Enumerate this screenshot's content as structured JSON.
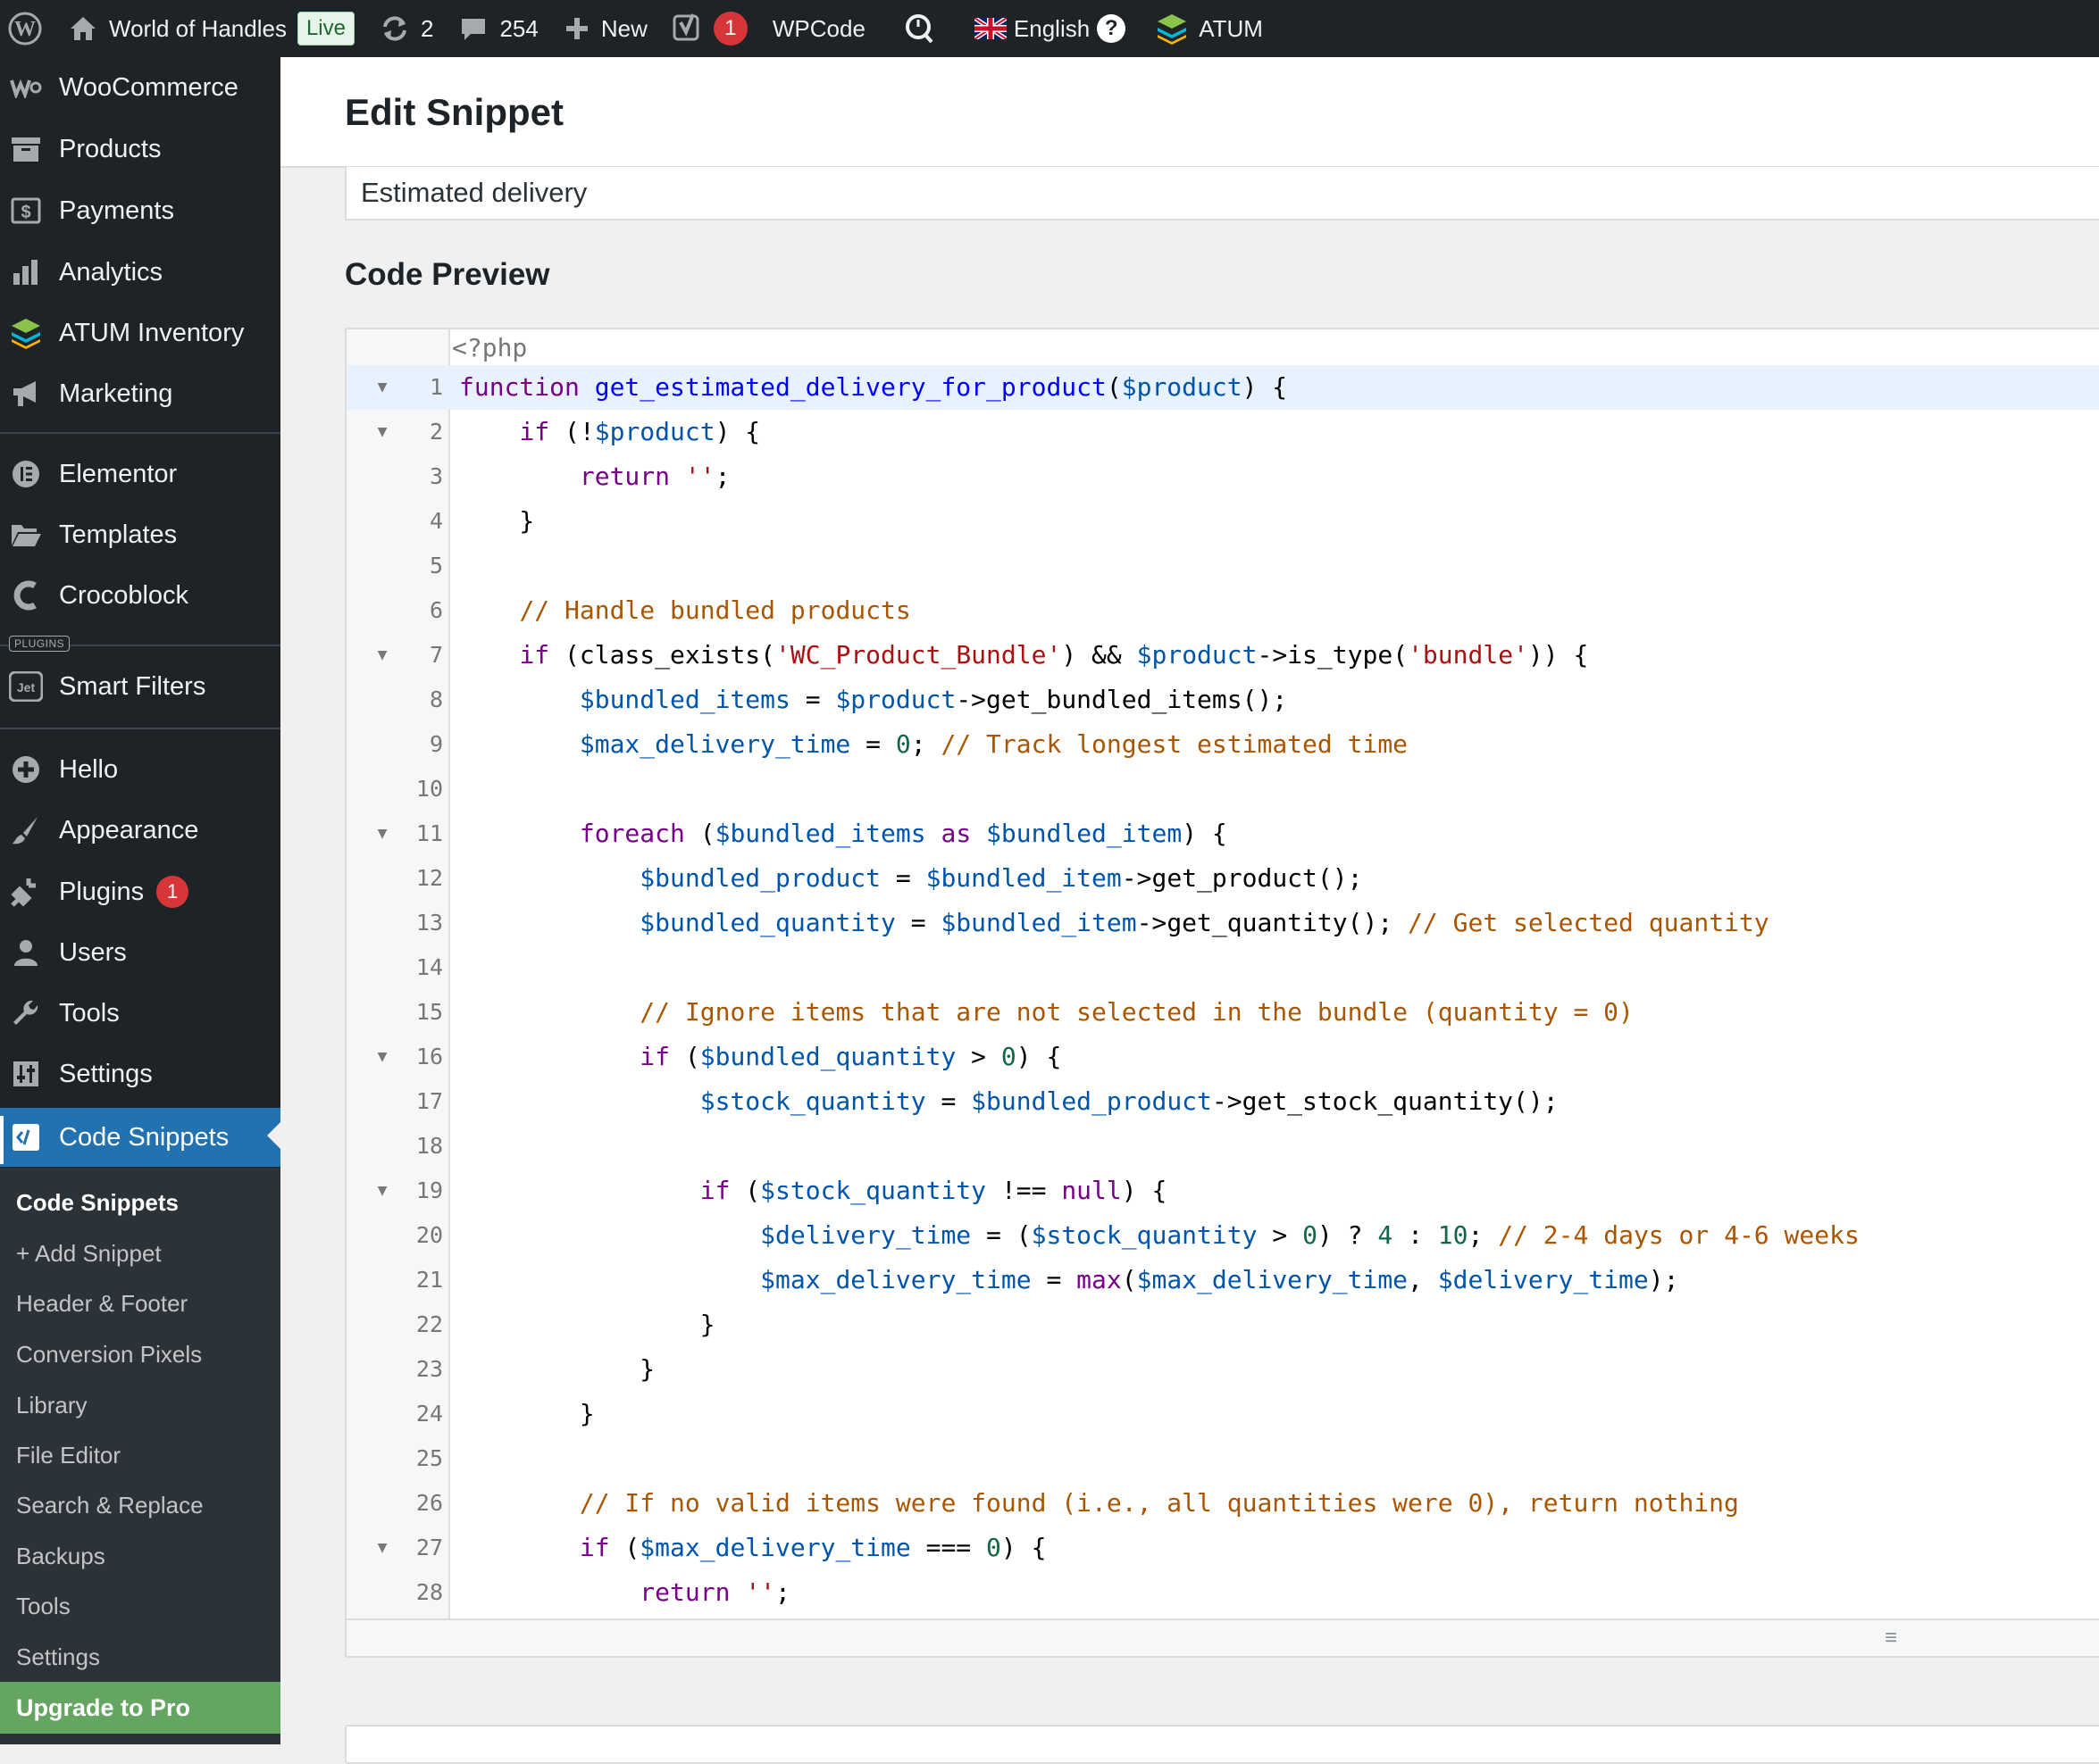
{
  "admin_bar": {
    "site_name": "World of Handles",
    "live_label": "Live",
    "updates_count": "2",
    "comments_count": "254",
    "new_label": "New",
    "yoast_count": "1",
    "wpcode_label": "WPCode",
    "language_label": "English",
    "help_label": "?",
    "atum_label": "ATUM"
  },
  "sidebar": {
    "items": [
      {
        "label": "WooCommerce",
        "icon": "woocommerce-icon"
      },
      {
        "label": "Products",
        "icon": "archive-icon"
      },
      {
        "label": "Payments",
        "icon": "money-icon"
      },
      {
        "label": "Analytics",
        "icon": "bar-chart-icon"
      },
      {
        "label": "ATUM Inventory",
        "icon": "atum-layers-icon"
      },
      {
        "label": "Marketing",
        "icon": "megaphone-icon"
      },
      {
        "label": "Elementor",
        "icon": "elementor-icon"
      },
      {
        "label": "Templates",
        "icon": "folder-icon"
      },
      {
        "label": "Crocoblock",
        "icon": "crocoblock-icon"
      },
      {
        "label": "Smart Filters",
        "icon": "jet-icon"
      },
      {
        "label": "Hello",
        "icon": "plus-circle-icon"
      },
      {
        "label": "Appearance",
        "icon": "paintbrush-icon"
      },
      {
        "label": "Plugins",
        "icon": "plug-icon",
        "badge": "1"
      },
      {
        "label": "Users",
        "icon": "user-icon"
      },
      {
        "label": "Tools",
        "icon": "wrench-icon"
      },
      {
        "label": "Settings",
        "icon": "sliders-icon"
      },
      {
        "label": "Code Snippets",
        "icon": "code-icon"
      }
    ],
    "plugins_separator": "PLUGINS",
    "submenu": [
      "Code Snippets",
      "+ Add Snippet",
      "Header & Footer",
      "Conversion Pixels",
      "Library",
      "File Editor",
      "Search & Replace",
      "Backups",
      "Tools",
      "Settings"
    ],
    "upgrade_label": "Upgrade to Pro"
  },
  "main": {
    "page_title": "Edit Snippet",
    "snippet_title_value": "Estimated delivery",
    "section_title": "Code Preview",
    "php_open_tag": "<?php",
    "resize_handle": "≡"
  },
  "code_lines": [
    {
      "n": "1",
      "fold": true,
      "hl": true,
      "html": "<span class=\"kw\">function</span> <span class=\"def\">get_estimated_delivery_for_product</span>(<span class=\"var\">$product</span>) {"
    },
    {
      "n": "2",
      "fold": true,
      "html": "    <span class=\"kw\">if</span> (!<span class=\"var\">$product</span>) {"
    },
    {
      "n": "3",
      "fold": false,
      "html": "        <span class=\"kw\">return</span> <span class=\"str\">''</span>;"
    },
    {
      "n": "4",
      "fold": false,
      "html": "    }"
    },
    {
      "n": "5",
      "fold": false,
      "html": ""
    },
    {
      "n": "6",
      "fold": false,
      "html": "    <span class=\"com\">// Handle bundled products</span>"
    },
    {
      "n": "7",
      "fold": true,
      "html": "    <span class=\"kw\">if</span> (class_exists(<span class=\"str\">'WC_Product_Bundle'</span>) &amp;&amp; <span class=\"var\">$product</span>-&gt;is_type(<span class=\"str\">'bundle'</span>)) {"
    },
    {
      "n": "8",
      "fold": false,
      "html": "        <span class=\"var\">$bundled_items</span> = <span class=\"var\">$product</span>-&gt;get_bundled_items();"
    },
    {
      "n": "9",
      "fold": false,
      "html": "        <span class=\"var\">$max_delivery_time</span> = <span class=\"num\">0</span>; <span class=\"com\">// Track longest estimated time</span>"
    },
    {
      "n": "10",
      "fold": false,
      "html": ""
    },
    {
      "n": "11",
      "fold": true,
      "html": "        <span class=\"kw\">foreach</span> (<span class=\"var\">$bundled_items</span> <span class=\"kw\">as</span> <span class=\"var\">$bundled_item</span>) {"
    },
    {
      "n": "12",
      "fold": false,
      "html": "            <span class=\"var\">$bundled_product</span> = <span class=\"var\">$bundled_item</span>-&gt;get_product();"
    },
    {
      "n": "13",
      "fold": false,
      "html": "            <span class=\"var\">$bundled_quantity</span> = <span class=\"var\">$bundled_item</span>-&gt;get_quantity(); <span class=\"com\">// Get selected quantity</span>"
    },
    {
      "n": "14",
      "fold": false,
      "html": ""
    },
    {
      "n": "15",
      "fold": false,
      "html": "            <span class=\"com\">// Ignore items that are not selected in the bundle (quantity = 0)</span>"
    },
    {
      "n": "16",
      "fold": true,
      "html": "            <span class=\"kw\">if</span> (<span class=\"var\">$bundled_quantity</span> &gt; <span class=\"num\">0</span>) {"
    },
    {
      "n": "17",
      "fold": false,
      "html": "                <span class=\"var\">$stock_quantity</span> = <span class=\"var\">$bundled_product</span>-&gt;get_stock_quantity();"
    },
    {
      "n": "18",
      "fold": false,
      "html": ""
    },
    {
      "n": "19",
      "fold": true,
      "html": "                <span class=\"kw\">if</span> (<span class=\"var\">$stock_quantity</span> !== <span class=\"kw\">null</span>) {"
    },
    {
      "n": "20",
      "fold": false,
      "html": "                    <span class=\"var\">$delivery_time</span> = (<span class=\"var\">$stock_quantity</span> &gt; <span class=\"num\">0</span>) ? <span class=\"num\">4</span> : <span class=\"num\">10</span>; <span class=\"com\">// 2-4 days or 4-6 weeks</span>"
    },
    {
      "n": "21",
      "fold": false,
      "html": "                    <span class=\"var\">$max_delivery_time</span> = <span class=\"kw\">max</span>(<span class=\"var\">$max_delivery_time</span>, <span class=\"var\">$delivery_time</span>);"
    },
    {
      "n": "22",
      "fold": false,
      "html": "                }"
    },
    {
      "n": "23",
      "fold": false,
      "html": "            }"
    },
    {
      "n": "24",
      "fold": false,
      "html": "        }"
    },
    {
      "n": "25",
      "fold": false,
      "html": ""
    },
    {
      "n": "26",
      "fold": false,
      "html": "        <span class=\"com\">// If no valid items were found (i.e., all quantities were 0), return nothing</span>"
    },
    {
      "n": "27",
      "fold": true,
      "html": "        <span class=\"kw\">if</span> (<span class=\"var\">$max_delivery_time</span> === <span class=\"num\">0</span>) {"
    },
    {
      "n": "28",
      "fold": false,
      "html": "            <span class=\"kw\">return</span> <span class=\"str\">''</span>;"
    }
  ],
  "colors": {
    "admin_bar_bg": "#1d2327",
    "active_menu_bg": "#2271b1",
    "upgrade_bg": "#63a561",
    "badge_red": "#d63638"
  }
}
